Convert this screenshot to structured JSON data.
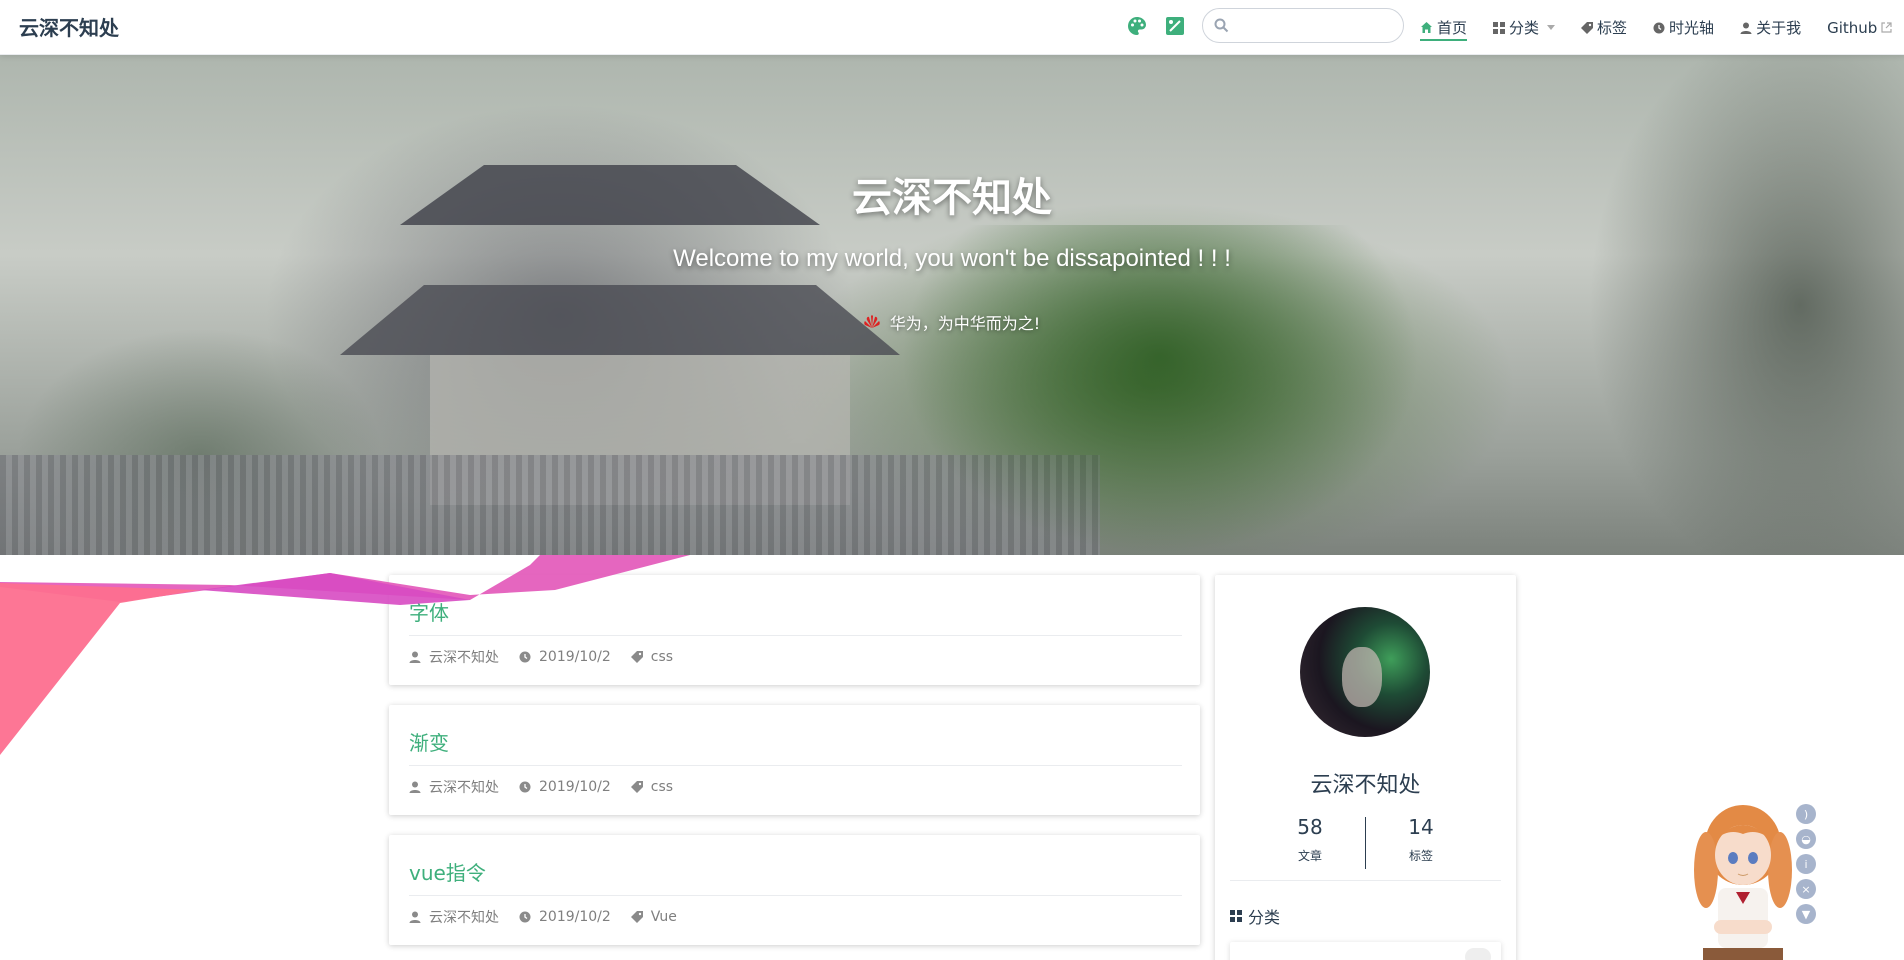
{
  "site": {
    "name": "云深不知处"
  },
  "nav": {
    "search_placeholder": "",
    "items": [
      {
        "label": "首页",
        "icon": "home-icon",
        "active": true
      },
      {
        "label": "分类",
        "icon": "grid-icon",
        "dropdown": true
      },
      {
        "label": "标签",
        "icon": "tag-icon"
      },
      {
        "label": "时光轴",
        "icon": "clock-icon"
      },
      {
        "label": "关于我",
        "icon": "user-icon"
      },
      {
        "label": "Github",
        "icon": "external-link-icon"
      }
    ]
  },
  "hero": {
    "title": "云深不知处",
    "description": "Welcome to my world, you won't be dissapointed ! ! !",
    "motto": "华为，为中华而为之!"
  },
  "posts": [
    {
      "title": "字体",
      "author": "云深不知处",
      "date": "2019/10/2",
      "tag": "css"
    },
    {
      "title": "渐变",
      "author": "云深不知处",
      "date": "2019/10/2",
      "tag": "css"
    },
    {
      "title": "vue指令",
      "author": "云深不知处",
      "date": "2019/10/2",
      "tag": "Vue"
    }
  ],
  "profile": {
    "name": "云深不知处",
    "stats": [
      {
        "num": "58",
        "label": "文章"
      },
      {
        "num": "14",
        "label": "标签"
      }
    ],
    "category_heading": "分类"
  },
  "colors": {
    "accent": "#3eaf7c",
    "text": "#2c3e50",
    "meta": "#7f7f7f"
  }
}
